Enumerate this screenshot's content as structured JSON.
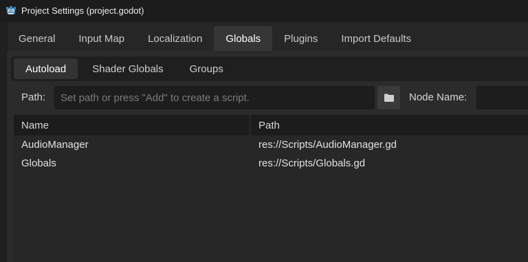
{
  "window": {
    "title": "Project Settings (project.godot)",
    "icon": "godot-icon"
  },
  "tabs": [
    {
      "label": "General",
      "active": false
    },
    {
      "label": "Input Map",
      "active": false
    },
    {
      "label": "Localization",
      "active": false
    },
    {
      "label": "Globals",
      "active": true
    },
    {
      "label": "Plugins",
      "active": false
    },
    {
      "label": "Import Defaults",
      "active": false
    }
  ],
  "subtabs": [
    {
      "label": "Autoload",
      "active": true
    },
    {
      "label": "Shader Globals",
      "active": false
    },
    {
      "label": "Groups",
      "active": false
    }
  ],
  "path_field": {
    "label": "Path:",
    "value": "",
    "placeholder": "Set path or press \"Add\" to create a script.",
    "browse_icon": "folder-icon"
  },
  "node_name_field": {
    "label": "Node Name:",
    "value": ""
  },
  "table": {
    "columns": [
      "Name",
      "Path"
    ],
    "rows": [
      {
        "name": "AudioManager",
        "path": "res://Scripts/AudioManager.gd"
      },
      {
        "name": "Globals",
        "path": "res://Scripts/Globals.gd"
      }
    ]
  },
  "colors": {
    "background": "#202020",
    "panel": "#2b2b2b",
    "active_tab": "#363636",
    "godot_blue": "#478cbf"
  }
}
